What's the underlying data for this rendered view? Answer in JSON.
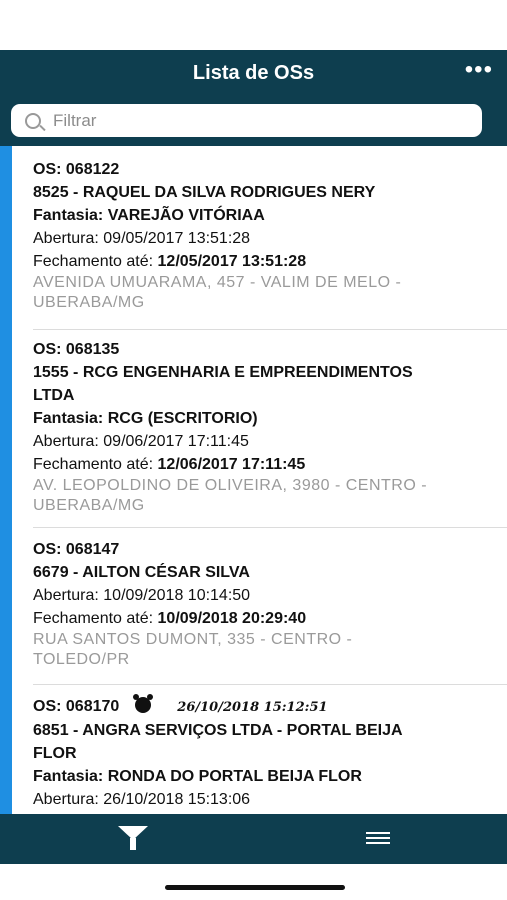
{
  "header": {
    "title": "Lista de OSs",
    "more_icon": "ellipsis-icon"
  },
  "search": {
    "placeholder": "Filtrar",
    "value": ""
  },
  "orders": [
    {
      "os": "OS: 068122",
      "client": "8525 - RAQUEL DA SILVA RODRIGUES NERY",
      "fantasia_label": "Fantasia:",
      "fantasia": "VAREJÃO VITÓRIAA",
      "abertura_label": "Abertura:",
      "abertura": "09/05/2017 13:51:28",
      "fechamento_label": "Fechamento até:",
      "fechamento": "12/05/2017 13:51:28",
      "address_1": "AVENIDA UMUARAMA, 457 - VALIM DE MELO -",
      "address_2": "UBERABA/MG"
    },
    {
      "os": "OS: 068135",
      "client_1": "1555 - RCG ENGENHARIA E EMPREENDIMENTOS",
      "client_2": "LTDA",
      "fantasia_label": "Fantasia:",
      "fantasia": "RCG (ESCRITORIO)",
      "abertura_label": "Abertura:",
      "abertura": "09/06/2017 17:11:45",
      "fechamento_label": "Fechamento até:",
      "fechamento": "12/06/2017 17:11:45",
      "address_1": "AV. LEOPOLDINO DE OLIVEIRA, 3980 - CENTRO -",
      "address_2": "UBERABA/MG"
    },
    {
      "os": "OS: 068147",
      "client": "6679 - AILTON CÉSAR SILVA",
      "abertura_label": "Abertura:",
      "abertura": "10/09/2018 10:14:50",
      "fechamento_label": "Fechamento até:",
      "fechamento": "10/09/2018 20:29:40",
      "address_1": "RUA SANTOS DUMONT, 335 - CENTRO -",
      "address_2": "TOLEDO/PR"
    },
    {
      "os": "OS: 068170",
      "alarm_time": "26/10/2018 15:12:51",
      "client_1": "6851 - ANGRA SERVIÇOS LTDA - PORTAL BEIJA",
      "client_2": "FLOR",
      "fantasia_label": "Fantasia:",
      "fantasia": "RONDA DO PORTAL BEIJA FLOR",
      "abertura_label": "Abertura:",
      "abertura": "26/10/2018 15:13:06"
    }
  ],
  "tabbar": {
    "filter_icon": "filter-icon",
    "menu_icon": "menu-icon"
  },
  "colors": {
    "header": "#0e3e4f",
    "accent": "#1f8fe2"
  }
}
